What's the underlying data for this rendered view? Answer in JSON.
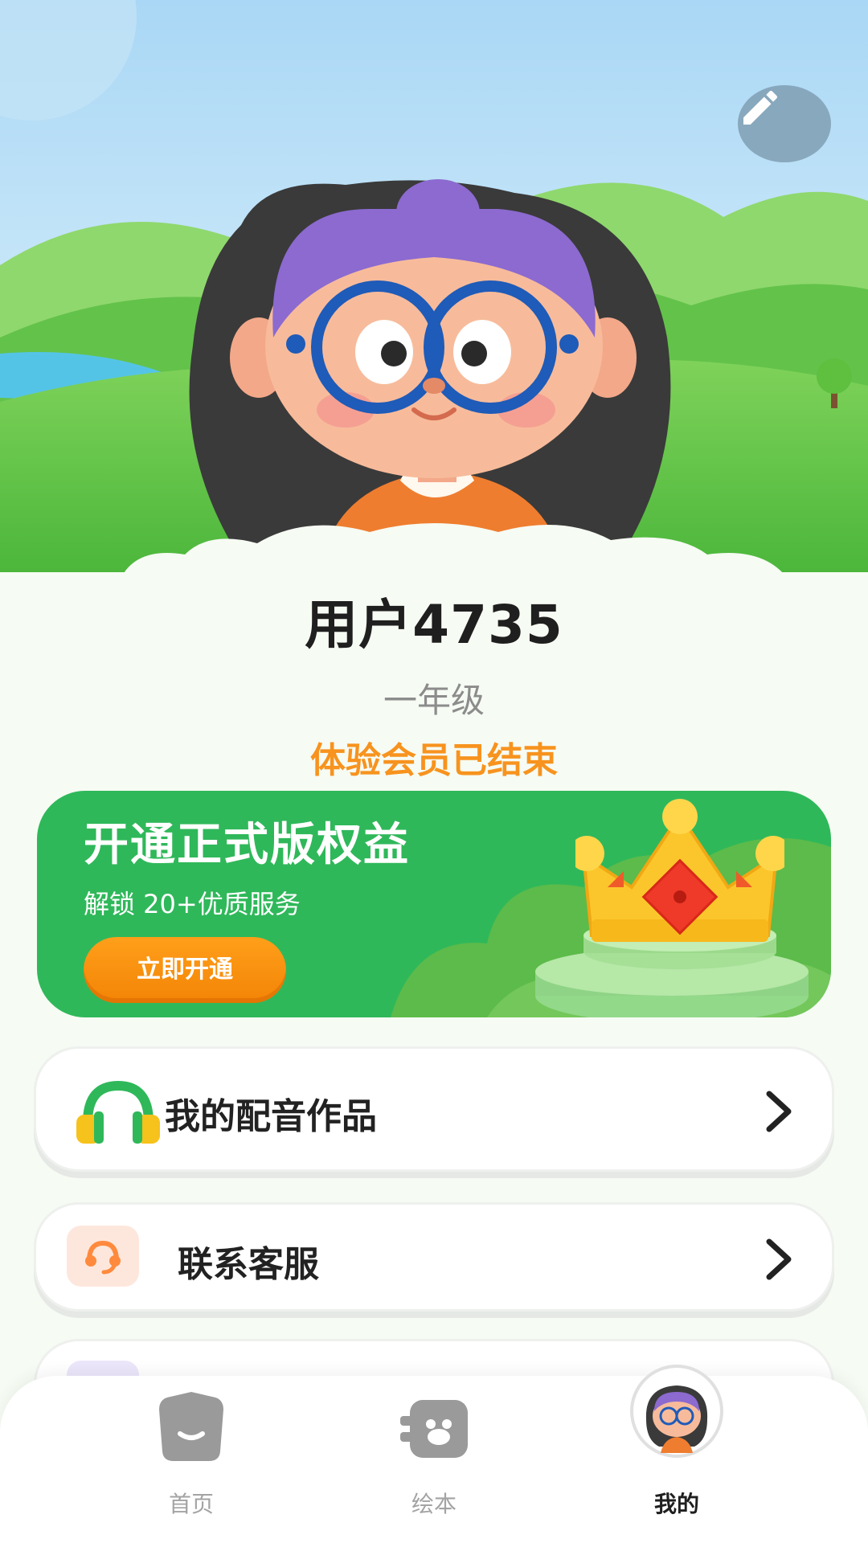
{
  "profile": {
    "username": "用户4735",
    "grade": "一年级",
    "membership_status": "体验会员已结束"
  },
  "hero": {
    "edit_icon": "pencil-icon"
  },
  "promo": {
    "title": "开通正式版权益",
    "subtitle": "解锁 20+优质服务",
    "button_label": "立即开通",
    "icon": "crown-icon"
  },
  "menu": {
    "items": [
      {
        "label": "我的配音作品",
        "icon": "headphones-icon"
      },
      {
        "label": "联系客服",
        "icon": "headset-icon"
      }
    ]
  },
  "tabbar": {
    "tabs": [
      {
        "label": "首页",
        "icon": "home-icon",
        "active": false
      },
      {
        "label": "绘本",
        "icon": "picture-book-icon",
        "active": false
      },
      {
        "label": "我的",
        "icon": "avatar-icon",
        "active": true
      }
    ]
  },
  "colors": {
    "accent_orange": "#f7931e",
    "promo_green": "#2fb85a",
    "background": "#f6fbf3"
  }
}
